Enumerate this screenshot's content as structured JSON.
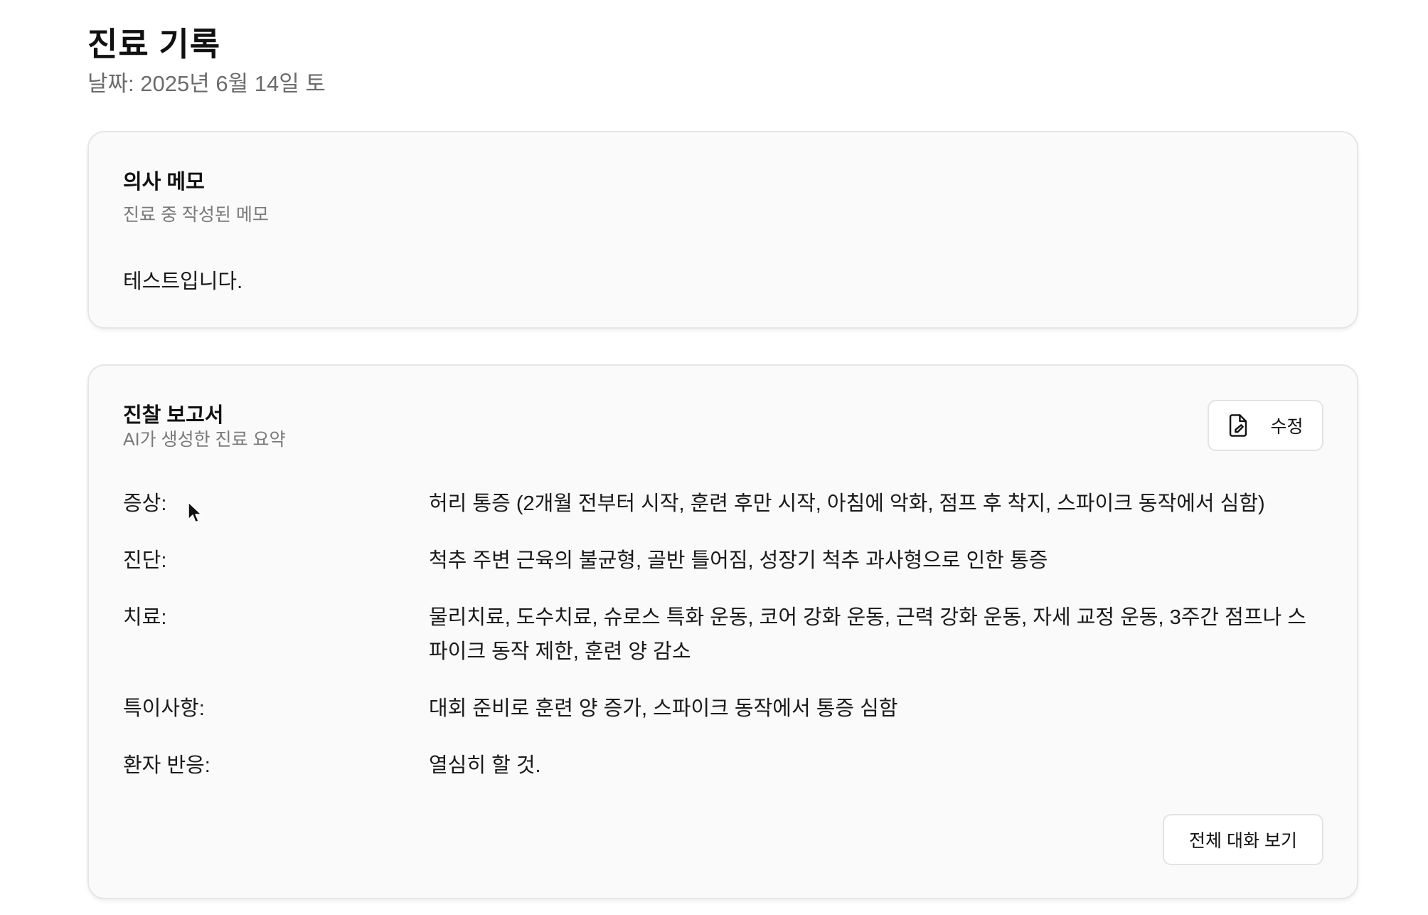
{
  "page": {
    "title": "진료 기록",
    "date": "날짜: 2025년 6월 14일 토"
  },
  "memo_card": {
    "title": "의사 메모",
    "subtitle": "진료 중 작성된 메모",
    "body": "테스트입니다."
  },
  "report_card": {
    "title": "진찰 보고서",
    "subtitle": "AI가 생성한 진료 요약",
    "edit_button": {
      "label": "수정",
      "icon": "document-edit-icon"
    },
    "rows": [
      {
        "label": "증상:",
        "value": "허리 통증 (2개월 전부터 시작, 훈련 후만 시작, 아침에 악화, 점프 후 착지, 스파이크 동작에서 심함)"
      },
      {
        "label": "진단:",
        "value": "척추 주변 근육의 불균형, 골반 틀어짐, 성장기 척추 과사형으로 인한 통증"
      },
      {
        "label": "치료:",
        "value": "물리치료, 도수치료, 슈로스 특화 운동, 코어 강화 운동, 근력 강화 운동, 자세 교정 운동, 3주간 점프나 스파이크 동작 제한, 훈련 양 감소"
      },
      {
        "label": "특이사항:",
        "value": "대회 준비로 훈련 양 증가, 스파이크 동작에서 통증 심함"
      },
      {
        "label": "환자 반응:",
        "value": "열심히 할 것."
      }
    ],
    "conversation_button": {
      "label": "전체 대화 보기"
    }
  }
}
